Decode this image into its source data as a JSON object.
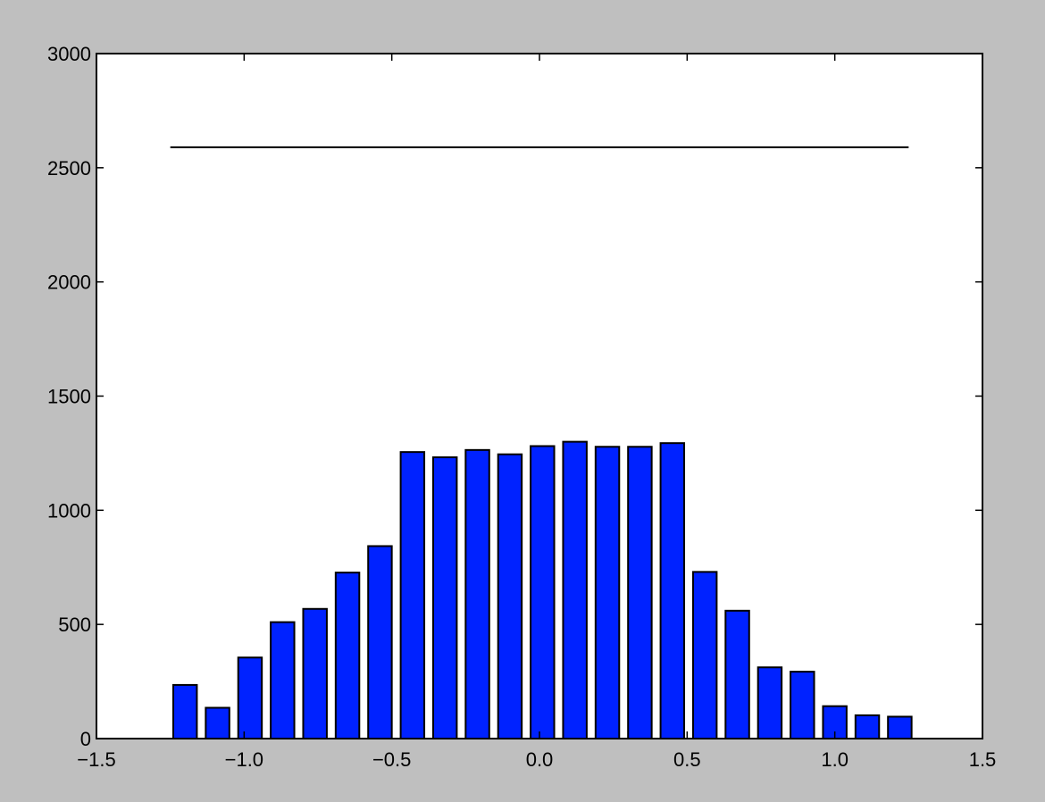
{
  "colors": {
    "figure_background": "#bfbfbf",
    "axes_background": "#ffffff",
    "bar_fill": "#0022ff",
    "bar_edge": "#000000",
    "line": "#000000"
  },
  "chart_data": {
    "type": "bar",
    "title": "",
    "xlabel": "",
    "ylabel": "",
    "xlim": [
      -1.5,
      1.5
    ],
    "ylim": [
      0,
      3000
    ],
    "grid": false,
    "legend": "none",
    "bar_width": 0.08,
    "x": [
      -1.2,
      -1.09,
      -0.98,
      -0.87,
      -0.76,
      -0.65,
      -0.54,
      -0.43,
      -0.32,
      -0.21,
      -0.1,
      0.01,
      0.12,
      0.23,
      0.34,
      0.45,
      0.56,
      0.67,
      0.78,
      0.89,
      1.0,
      1.11,
      1.22
    ],
    "values": [
      235,
      135,
      355,
      510,
      568,
      727,
      843,
      1255,
      1232,
      1264,
      1245,
      1281,
      1300,
      1278,
      1278,
      1294,
      730,
      560,
      312,
      293,
      142,
      102,
      96
    ],
    "line": {
      "x": [
        -1.25,
        1.25
      ],
      "y": [
        2590,
        2590
      ]
    },
    "xticks": [
      -1.5,
      -1.0,
      -0.5,
      0.0,
      0.5,
      1.0,
      1.5
    ],
    "xtick_labels": [
      "−1.5",
      "−1.0",
      "−0.5",
      "0.0",
      "0.5",
      "1.0",
      "1.5"
    ],
    "yticks": [
      0,
      500,
      1000,
      1500,
      2000,
      2500,
      3000
    ],
    "ytick_labels": [
      "0",
      "500",
      "1000",
      "1500",
      "2000",
      "2500",
      "3000"
    ]
  }
}
